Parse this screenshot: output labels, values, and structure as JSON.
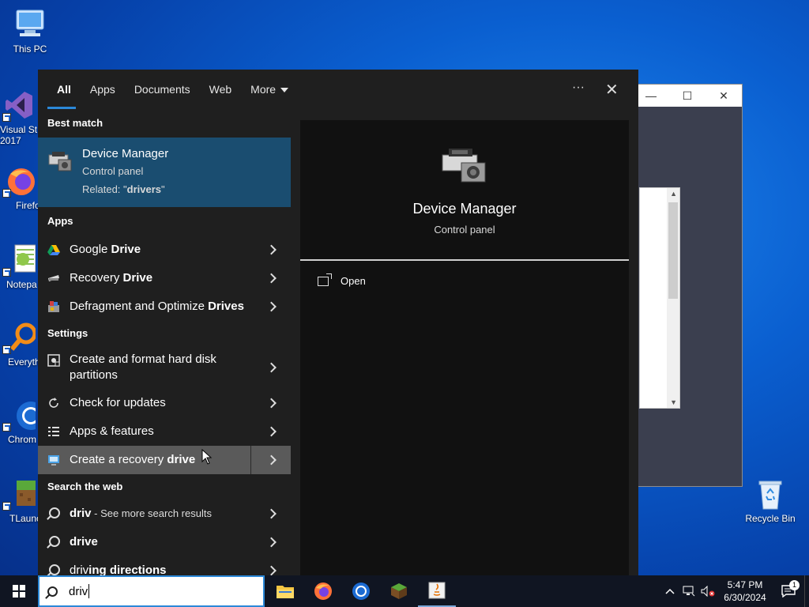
{
  "desktop": {
    "icons": [
      {
        "label": "This PC"
      },
      {
        "label": "Visual St\n2017"
      },
      {
        "label": "Firefo"
      },
      {
        "label": "Notepa"
      },
      {
        "label": "Everyth"
      },
      {
        "label": "Chrom"
      },
      {
        "label": "TLaunc"
      },
      {
        "label": "Recycle Bin"
      }
    ]
  },
  "search_panel": {
    "tabs": [
      {
        "label": "All",
        "active": true
      },
      {
        "label": "Apps"
      },
      {
        "label": "Documents"
      },
      {
        "label": "Web"
      },
      {
        "label": "More"
      }
    ],
    "more_options_glyph": "···",
    "close_glyph": "✕",
    "best_match": {
      "section": "Best match",
      "title": "Device Manager",
      "subtitle": "Control panel",
      "related_prefix": "Related: \"",
      "related_bold": "drivers",
      "related_suffix": "\"",
      "icon": "device-manager-icon"
    },
    "apps": {
      "section": "Apps",
      "items": [
        {
          "pre": "Google ",
          "bold": "Drive",
          "icon": "google-drive-icon"
        },
        {
          "pre": "Recovery ",
          "bold": "Drive",
          "icon": "recovery-drive-icon"
        },
        {
          "pre": "Defragment and Optimize ",
          "bold": "Drives",
          "icon": "defrag-icon"
        }
      ]
    },
    "settings": {
      "section": "Settings",
      "items": [
        {
          "label": "Create and format hard disk partitions",
          "icon": "disk-partition-icon"
        },
        {
          "label": "Check for updates",
          "icon": "update-icon"
        },
        {
          "label": "Apps & features",
          "icon": "apps-features-icon"
        },
        {
          "pre": "Create a recovery ",
          "bold": "drive",
          "icon": "recovery-icon",
          "hovered": true
        }
      ]
    },
    "web": {
      "section": "Search the web",
      "items": [
        {
          "bold": "driv",
          "suffix": " - See more search results"
        },
        {
          "pre": "driv",
          "plain": "e"
        },
        {
          "pre": "driv",
          "bold": "ing directions"
        }
      ]
    },
    "preview": {
      "title": "Device Manager",
      "subtitle": "Control panel",
      "actions": [
        {
          "label": "Open",
          "icon": "open-icon"
        }
      ]
    }
  },
  "taskbar": {
    "search_value": "driv",
    "apps": [
      "file-explorer-icon",
      "firefox-icon",
      "chrome-icon",
      "minecraft-icon",
      "java-icon"
    ],
    "clock": {
      "time": "5:47 PM",
      "date": "6/30/2024"
    },
    "notification_count": "1"
  },
  "colors": {
    "accent": "#2b88d8",
    "best_match_bg": "#1a4d70",
    "panel_bg": "#1f1f1f",
    "preview_bg": "#111111",
    "hover_bg": "#5a5a5a"
  }
}
